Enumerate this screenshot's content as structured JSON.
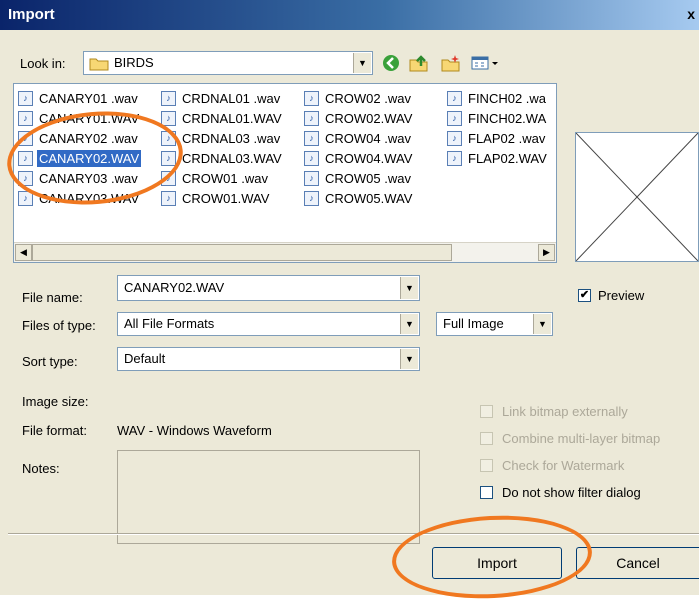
{
  "window": {
    "title": "Import",
    "close_glyph": "x"
  },
  "toolbar": {
    "look_in_label": "Look in:",
    "look_in_value": "BIRDS",
    "icons": [
      "back-icon",
      "up-folder-icon",
      "new-folder-icon",
      "view-menu-icon"
    ]
  },
  "file_list": {
    "columns": [
      [
        "CANARY01 .wav",
        "CANARY01.WAV",
        "CANARY02 .wav",
        "CANARY02.WAV",
        "CANARY03 .wav",
        "CANARY03.WAV"
      ],
      [
        "CRDNAL01 .wav",
        "CRDNAL01.WAV",
        "CRDNAL03 .wav",
        "CRDNAL03.WAV",
        "CROW01 .wav",
        "CROW01.WAV"
      ],
      [
        "CROW02 .wav",
        "CROW02.WAV",
        "CROW04 .wav",
        "CROW04.WAV",
        "CROW05 .wav",
        "CROW05.WAV"
      ],
      [
        "FINCH02 .wa",
        "FINCH02.WA",
        "FLAP02 .wav",
        "FLAP02.WAV"
      ]
    ],
    "selected": "CANARY02.WAV"
  },
  "form": {
    "file_name_label": "File name:",
    "file_name_value": "CANARY02.WAV",
    "files_of_type_label": "Files of type:",
    "files_of_type_value": "All File Formats",
    "image_mode_value": "Full Image",
    "sort_type_label": "Sort type:",
    "sort_type_value": "Default",
    "image_size_label": "Image size:",
    "file_format_label": "File format:",
    "file_format_value": "WAV - Windows Waveform",
    "notes_label": "Notes:"
  },
  "preview": {
    "label": "Preview",
    "checked": true
  },
  "options": {
    "link_bitmap": "Link bitmap externally",
    "combine_multilayer": "Combine multi-layer bitmap",
    "check_watermark": "Check for Watermark",
    "no_filter_dialog": "Do not show filter dialog"
  },
  "buttons": {
    "import": "Import",
    "cancel": "Cancel"
  },
  "colors": {
    "annotation_ring": "#f07820",
    "selection": "#316ac5",
    "titlebar": "#0a246a"
  }
}
